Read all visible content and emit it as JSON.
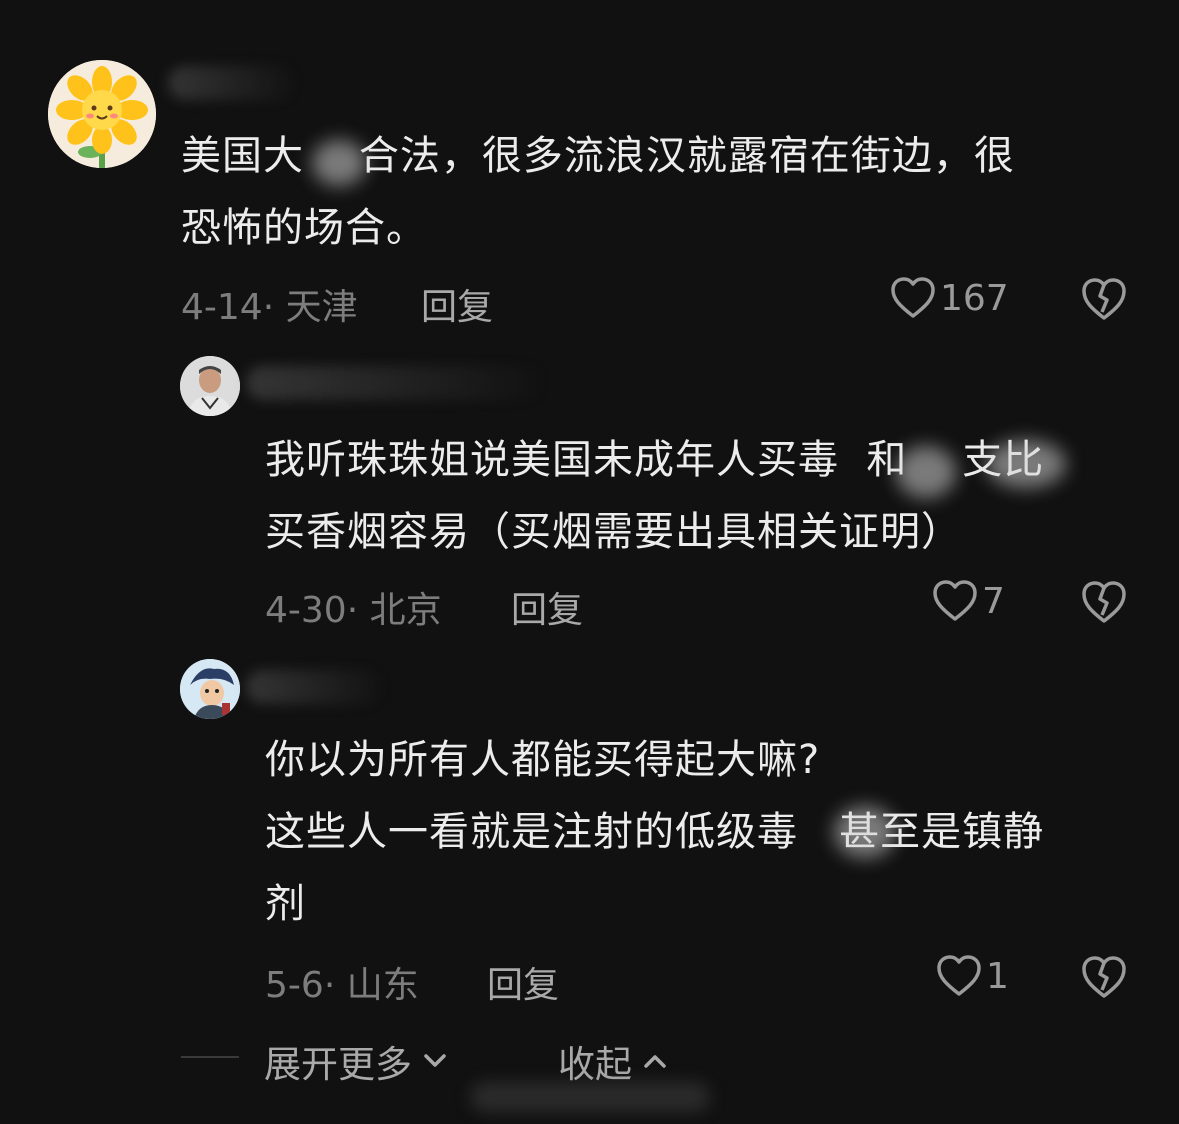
{
  "colors": {
    "background": "#111111",
    "text": "#ececec",
    "meta": "#7d7d7d",
    "action": "#a9a9a9"
  },
  "comments": [
    {
      "text": "美国大    合法，很多流浪汉就露宿在街边，很\n恐怖的场合。",
      "date": "4-14",
      "location": "天津",
      "reply_label": "回复",
      "likes": "167",
      "avatar_icon": "sunflower-avatar"
    },
    {
      "text": "我听珠珠姐说美国未成年人买毒  和    支比\n买香烟容易（买烟需要出具相关证明）",
      "date": "4-30",
      "location": "北京",
      "reply_label": "回复",
      "likes": "7",
      "avatar_icon": "man-photo-avatar"
    },
    {
      "text": "你以为所有人都能买得起大嘛?\n这些人一看就是注射的低级毒   甚至是镇静\n剂",
      "date": "5-6",
      "location": "山东",
      "reply_label": "回复",
      "likes": "1",
      "avatar_icon": "cartoon-avatar"
    }
  ],
  "footer": {
    "expand_label": "展开更多",
    "collapse_label": "收起"
  }
}
